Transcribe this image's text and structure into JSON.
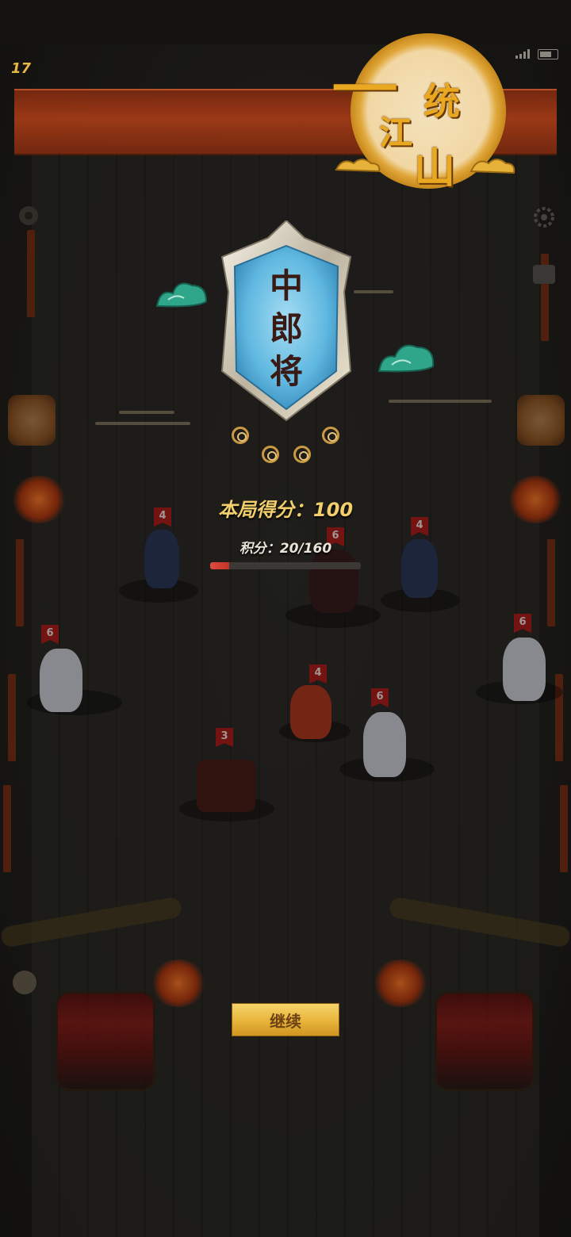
{
  "hud": {
    "level": "17"
  },
  "emblem": {
    "chars": [
      "一",
      "统",
      "江",
      "山"
    ]
  },
  "rank": {
    "title_chars": [
      "中",
      "郎",
      "将"
    ],
    "knot_count": 5
  },
  "result": {
    "score_label": "本局得分：100",
    "points_label": "积分：20/160",
    "points_progress": 0.125
  },
  "units": [
    {
      "count": "4"
    },
    {
      "count": "6"
    },
    {
      "count": "4"
    },
    {
      "count": "6"
    },
    {
      "count": "6"
    },
    {
      "count": "4"
    },
    {
      "count": "6"
    },
    {
      "count": "3"
    }
  ],
  "actions": {
    "continue_label": "继续"
  },
  "colors": {
    "banner": "#a73c17",
    "gold": "#f2cf6b",
    "plaque_blue": "#5fb8e0",
    "flag_red": "#b11f1c",
    "progress_red": "#e04b3e"
  }
}
